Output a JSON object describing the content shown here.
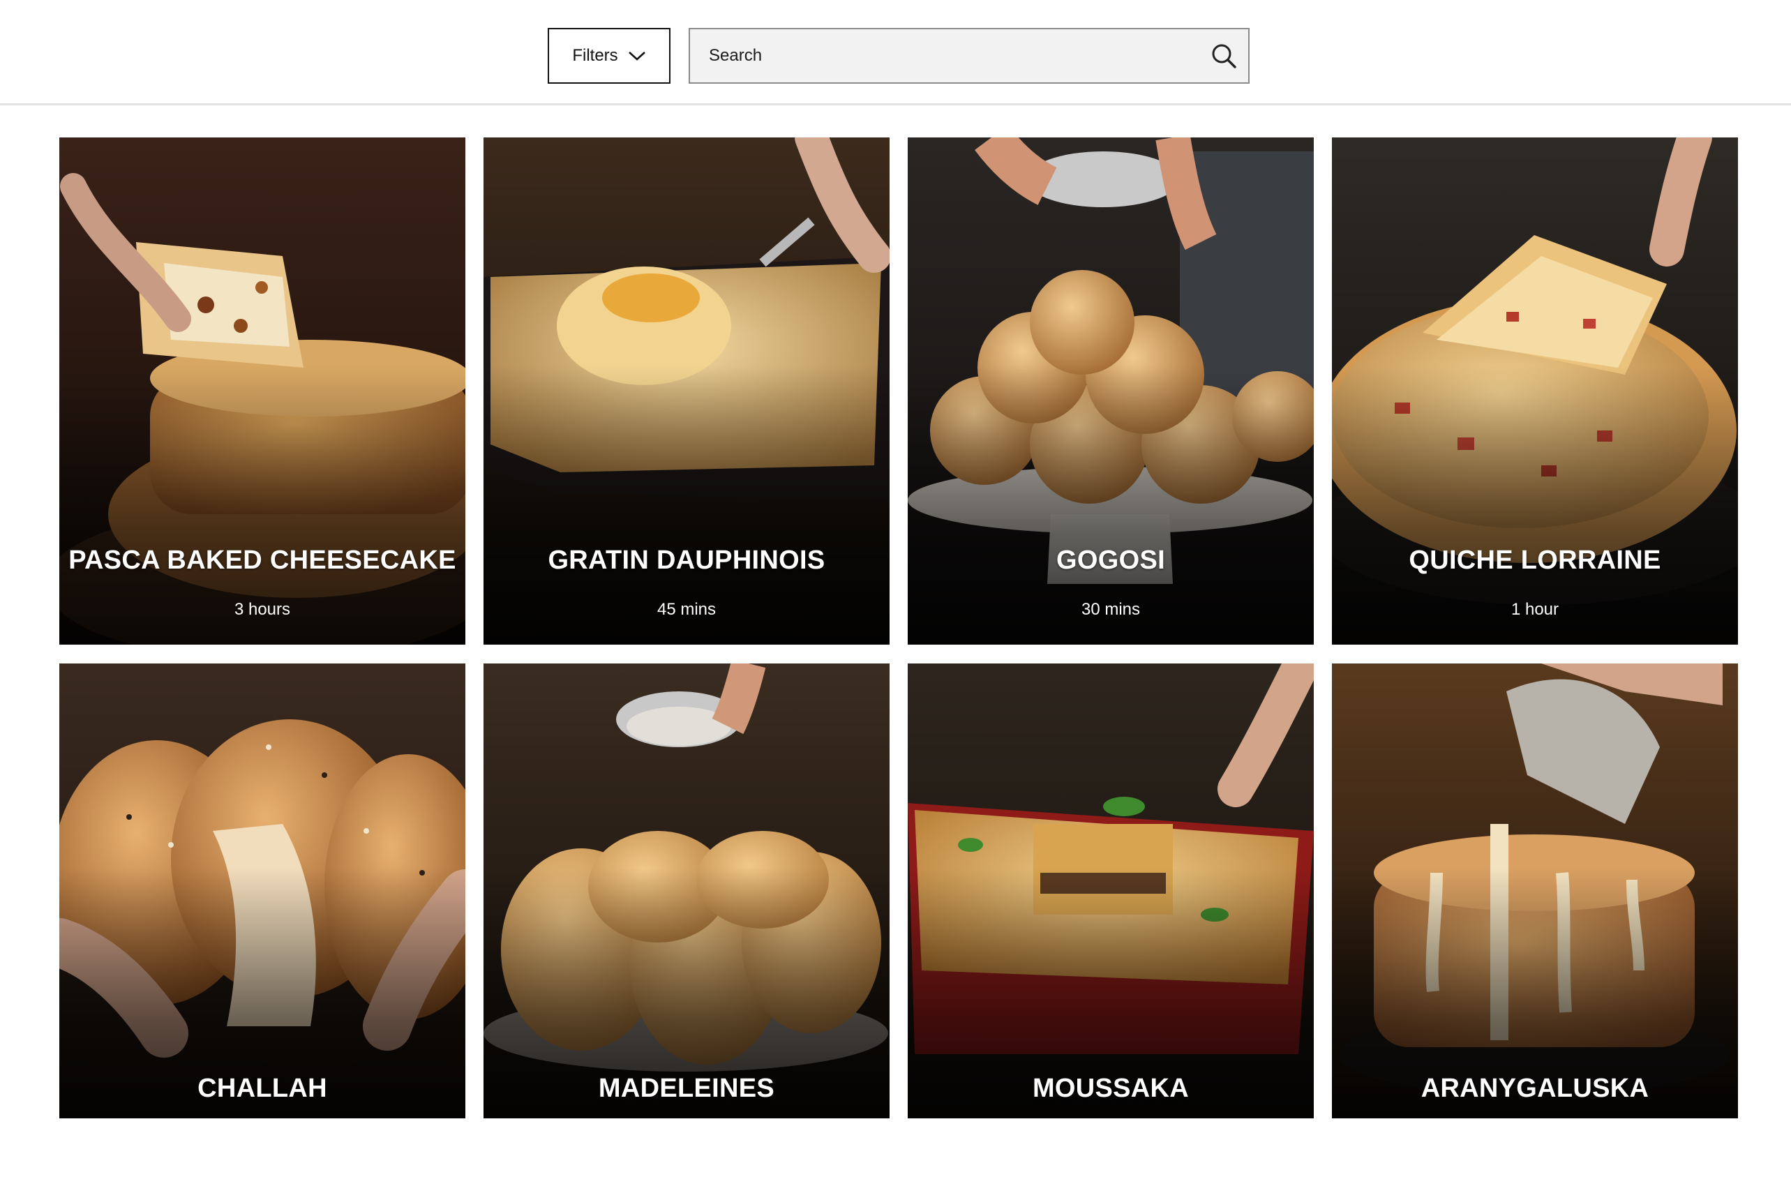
{
  "toolbar": {
    "filters_label": "Filters",
    "search_placeholder": "Search"
  },
  "icons": {
    "filters": "chevron-down-icon",
    "search": "search-icon"
  },
  "recipes": [
    {
      "title": "PASCA BAKED CHEESECAKE",
      "time": "3 hours"
    },
    {
      "title": "GRATIN DAUPHINOIS",
      "time": "45 mins"
    },
    {
      "title": "GOGOSI",
      "time": "30 mins"
    },
    {
      "title": "QUICHE LORRAINE",
      "time": "1 hour"
    },
    {
      "title": "CHALLAH"
    },
    {
      "title": "MADELEINES"
    },
    {
      "title": "MOUSSAKA"
    },
    {
      "title": "ARANYGALUSKA"
    }
  ]
}
